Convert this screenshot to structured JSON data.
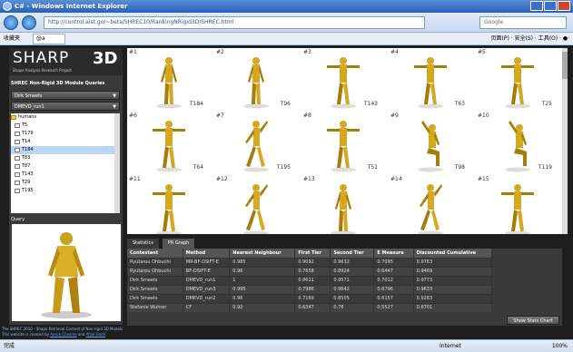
{
  "window": {
    "title": "C# - Windows Internet Explorer"
  },
  "address": {
    "url": "http://control.aist.go/~beta/SHREC10/RankingNRigid3D/SHREC.html",
    "search_placeholder": "Google"
  },
  "favbar": {
    "favorites": "收藏夹",
    "tab": "@a",
    "tools": "页面(P) · 安全(S) · 工具(O) · ●·"
  },
  "sidebar": {
    "logo": "SHARP",
    "logo_3d": "3D",
    "logo_sub": "Shape Analysis Research Project",
    "module_title": "SHREC Non-Rigid 3D Module Queries",
    "dropdown1": "Dirk Smeets",
    "dropdown2": "DMEVD_run1",
    "tree": [
      {
        "label": "humans",
        "folder": true
      },
      {
        "label": "T5"
      },
      {
        "label": "T179"
      },
      {
        "label": "T14"
      },
      {
        "label": "T184",
        "selected": true
      },
      {
        "label": "T83"
      },
      {
        "label": "T87"
      },
      {
        "label": "T143"
      },
      {
        "label": "T29"
      },
      {
        "label": "T195"
      }
    ],
    "query_label": "Query"
  },
  "results": [
    {
      "num": "#1",
      "label": "T184",
      "pose": "stand"
    },
    {
      "num": "#2",
      "label": "T96",
      "pose": "stand"
    },
    {
      "num": "#3",
      "label": "T143",
      "pose": "tpose"
    },
    {
      "num": "#4",
      "label": "T63",
      "pose": "tpose"
    },
    {
      "num": "#5",
      "label": "T25",
      "pose": "tpose"
    },
    {
      "num": "#6",
      "label": "T64",
      "pose": "tpose"
    },
    {
      "num": "#7",
      "label": "T195",
      "pose": "walk"
    },
    {
      "num": "#8",
      "label": "T51",
      "pose": "tpose"
    },
    {
      "num": "#9",
      "label": "T98",
      "pose": "sit"
    },
    {
      "num": "#10",
      "label": "T119",
      "pose": "sit"
    },
    {
      "num": "#11",
      "label": "",
      "pose": "tpose"
    },
    {
      "num": "#12",
      "label": "",
      "pose": "walk"
    },
    {
      "num": "#13",
      "label": "",
      "pose": "stand"
    },
    {
      "num": "#14",
      "label": "",
      "pose": "walk"
    },
    {
      "num": "#15",
      "label": "",
      "pose": "tpose"
    }
  ],
  "tabs": [
    "Statistics",
    "PR Graph"
  ],
  "stats": {
    "headers": [
      "Contestant",
      "Method",
      "Nearest Neighbour",
      "First Tier",
      "Second Tier",
      "E Measure",
      "Discounted Cumulative"
    ],
    "rows": [
      [
        "Ryutarou Ohbuchi",
        "MR-BF-DSIFT-E",
        "0.985",
        "0.9092",
        "0.9632",
        "0.7095",
        "0.9763"
      ],
      [
        "Ryutarou Ohbuchi",
        "BF-DSIFT-E",
        "0.96",
        "0.7658",
        "0.8924",
        "0.6447",
        "0.9469"
      ],
      [
        "Dirk Smeets",
        "DMEVD_run1",
        "1",
        "0.8611",
        "0.9571",
        "0.7012",
        "0.9773"
      ],
      [
        "Dirk Smeets",
        "DMEVD_run3",
        "0.995",
        "0.7986",
        "0.9642",
        "0.6796",
        "0.9633"
      ],
      [
        "Dirk Smeets",
        "DMEVD_run2",
        "0.96",
        "0.7169",
        "0.8505",
        "0.6157",
        "0.9283"
      ],
      [
        "Stefanie Wuhrer",
        "CF",
        "0.92",
        "0.6347",
        "0.78",
        "0.5527",
        "0.8701"
      ]
    ],
    "show_button": "Show Stats Chart"
  },
  "footer": {
    "line1": "The SHREC 2010 - Shape Retrieval Contest of Non-rigid 3D Models",
    "line2_prefix": "This website is created by",
    "author1": "Aaron Chasma",
    "and": "and",
    "author2": "Afzal Godil"
  },
  "status": {
    "done": "完成",
    "zone": "Internet",
    "zoom": "100%"
  }
}
